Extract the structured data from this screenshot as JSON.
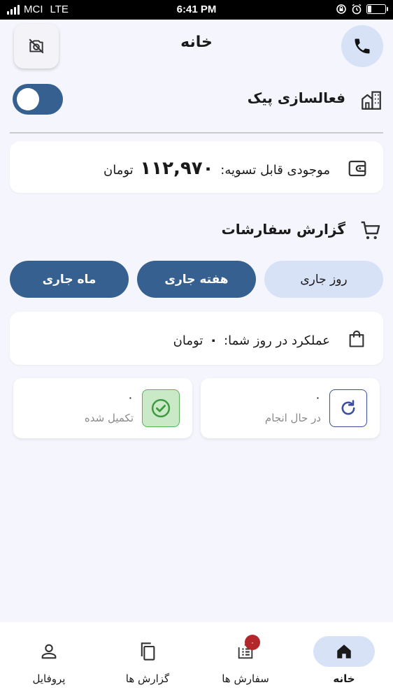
{
  "status_bar": {
    "carrier": "MCI",
    "network": "LTE",
    "time": "6:41 PM",
    "battery_level": 0.2
  },
  "header": {
    "title": "خانه",
    "left_icon": "camera-off-icon",
    "right_icon": "phone-icon"
  },
  "activation": {
    "label": "فعالسازی پیک",
    "toggle_on": true,
    "icon": "building-icon"
  },
  "balance": {
    "label": "موجودی قابل تسویه:",
    "amount": "۱۱۲,۹۷۰",
    "currency": "تومان",
    "icon": "wallet-icon"
  },
  "orders_report": {
    "title": "گزارش سفارشات",
    "icon": "cart-icon",
    "periods": [
      {
        "label": "روز جاری",
        "active": true
      },
      {
        "label": "هفته جاری",
        "active": false
      },
      {
        "label": "ماه جاری",
        "active": false
      }
    ]
  },
  "performance": {
    "label": "عملکرد در روز شما:",
    "amount": "۰",
    "currency": "تومان",
    "icon": "shopping-bag-icon"
  },
  "stats": {
    "in_progress": {
      "count": "۰",
      "label": "در حال انجام",
      "icon": "refresh-icon"
    },
    "completed": {
      "count": "۰",
      "label": "تکمیل شده",
      "icon": "check-circle-icon"
    }
  },
  "bottom_nav": [
    {
      "label": "خانه",
      "icon": "home-icon",
      "active": true
    },
    {
      "label": "سفارش ها",
      "icon": "orders-icon",
      "badge": "۰"
    },
    {
      "label": "گزارش ها",
      "icon": "copy-icon"
    },
    {
      "label": "پروفایل",
      "icon": "person-icon"
    }
  ],
  "colors": {
    "primary": "#35608f",
    "primary_light": "#d8e2f6",
    "background": "#f5f6fd",
    "success_bg": "#c9e9c7",
    "success": "#58b05a",
    "badge_red": "#b3262b"
  }
}
